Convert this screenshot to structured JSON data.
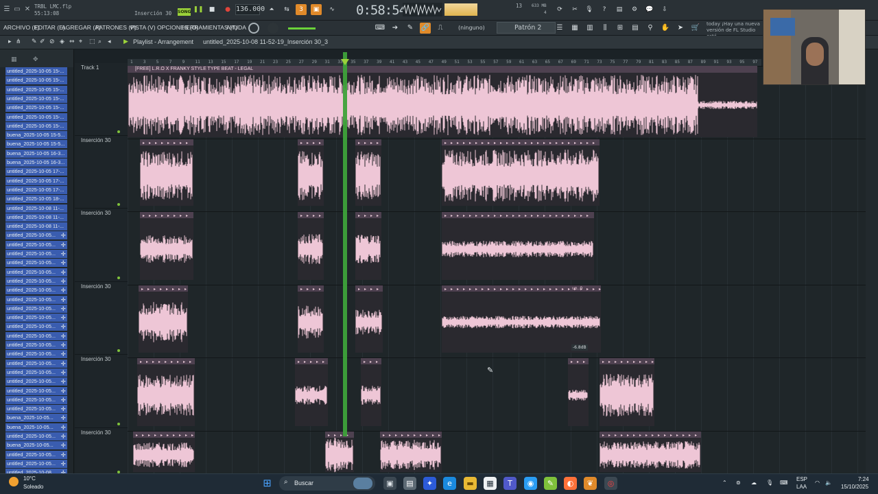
{
  "topbar": {
    "project_file": "TRBL LMC.flp",
    "elapsed": "55:13:08",
    "hint_label": "Inserción 30",
    "song_button": "SONG",
    "tempo": "136.000",
    "time": "0:58:54",
    "cpu_value": "13",
    "memory": "633 MB",
    "polyphony": "4"
  },
  "menubar": {
    "items": [
      "ARCHIVO (F)",
      "EDITAR (E)",
      "AGREGAR (A)",
      "PATRONES (P)",
      "VISTA (V)",
      "OPCIONES (O)",
      "HERRAMIENTAS (T)",
      "AYUDA"
    ],
    "none_label": "(ninguno)",
    "pattern": "Patrón 2",
    "news_line1": "today ¡Hay una nueva",
    "news_line2": "versión de FL Studio está"
  },
  "playlist": {
    "title": "Playlist - Arrangement",
    "path": "untitled_2025-10-08 11-52-19_Inserción 30_3",
    "top_clip_label": "[FREE] L.R.O X FRANKY STYLE TYPE BEAT - LEGAL",
    "db_label": "-6.8dB",
    "clip_label_un": "un..0"
  },
  "ruler": {
    "ticks": [
      "1",
      "3",
      "5",
      "7",
      "9",
      "11",
      "13",
      "15",
      "17",
      "19",
      "21",
      "23",
      "25",
      "27",
      "29",
      "31",
      "33",
      "35",
      "37",
      "39",
      "41",
      "43",
      "45",
      "47",
      "49",
      "51",
      "53",
      "55",
      "57",
      "59",
      "61",
      "63",
      "65",
      "67",
      "69",
      "71",
      "73",
      "75",
      "77",
      "79",
      "81",
      "83",
      "85",
      "87",
      "89",
      "91",
      "93",
      "95",
      "97"
    ]
  },
  "tracks": [
    {
      "name": "Track 1"
    },
    {
      "name": "Inserción 30"
    },
    {
      "name": "Inserción 30"
    },
    {
      "name": "Inserción 30"
    },
    {
      "name": "Inserción 30"
    },
    {
      "name": "Inserción 30"
    }
  ],
  "browser": {
    "items": [
      "untitled_2025-10-05 15-...",
      "untitled_2025-10-05 15-...",
      "untitled_2025-10-05 15-...",
      "untitled_2025-10-05 15-...",
      "untitled_2025-10-05 15-...",
      "untitled_2025-10-05 15-...",
      "untitled_2025-10-05 15-...",
      "buena_2025-10-05 15-5...",
      "buena_2025-10-05 15-5...",
      "buena_2025-10-05 16-3...",
      "buena_2025-10-05 16-3...",
      "untitled_2025-10-05 17-...",
      "untitled_2025-10-05 17-...",
      "untitled_2025-10-05 17-...",
      "untitled_2025-10-05 18-...",
      "untitled_2025-10-08 11-...",
      "untitled_2025-10-08 11-...",
      "untitled_2025-10-08 11-...",
      "untitled_2025-10-05...",
      "untitled_2025-10-05...",
      "untitled_2025-10-05...",
      "untitled_2025-10-05...",
      "untitled_2025-10-05...",
      "untitled_2025-10-05...",
      "untitled_2025-10-05...",
      "untitled_2025-10-05...",
      "untitled_2025-10-05...",
      "untitled_2025-10-05...",
      "untitled_2025-10-05...",
      "untitled_2025-10-05...",
      "untitled_2025-10-05...",
      "untitled_2025-10-05...",
      "untitled_2025-10-05...",
      "untitled_2025-10-05...",
      "untitled_2025-10-05...",
      "untitled_2025-10-05...",
      "untitled_2025-10-05...",
      "untitled_2025-10-05...",
      "buena_2025-10-05...",
      "buena_2025-10-05...",
      "untitled_2025-10-05...",
      "buena_2025-10-05...",
      "untitled_2025-10-05...",
      "untitled_2025-10-05...",
      "untitled_2025-10-08...",
      "untitled_2025-10-08..."
    ]
  },
  "taskbar": {
    "temperature": "10°C",
    "weather": "Soleado",
    "search": "Buscar",
    "lang1": "ESP",
    "lang2": "LAA",
    "clock_time": "7:24",
    "clock_date": "15/10/2025"
  },
  "colors": {
    "clip_pink": "#eec6d6",
    "playhead_green": "#3ea23a",
    "accent_orange": "#e08a2a",
    "browser_highlight": "#3a5db0"
  }
}
